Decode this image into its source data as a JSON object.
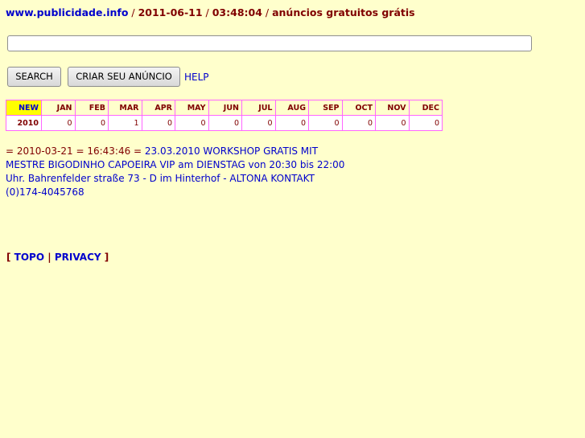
{
  "header": {
    "site": "www.publicidade.info",
    "date": "2011-06-11",
    "time": "03:48:04",
    "tagline": "anúncios gratuitos grátis",
    "separator": " / "
  },
  "search": {
    "value": "",
    "placeholder": ""
  },
  "buttons": {
    "search_label": "SEARCH",
    "create_label": "CRIAR SEU ANÚNCIO",
    "help_label": "HELP"
  },
  "calendar": {
    "new_label": "NEW",
    "months": [
      "JAN",
      "FEB",
      "MAR",
      "APR",
      "MAY",
      "JUN",
      "JUL",
      "AUG",
      "SEP",
      "OCT",
      "NOV",
      "DEC"
    ],
    "year": "2010",
    "counts": [
      "0",
      "0",
      "1",
      "0",
      "0",
      "0",
      "0",
      "0",
      "0",
      "0",
      "0",
      "0"
    ]
  },
  "listing": {
    "prefix": "= ",
    "date": "2010-03-21",
    "eq1": " = ",
    "time": "16:43:46",
    "eq2": " = ",
    "text": "23.03.2010 WORKSHOP GRATIS MIT MESTRE BIGODINHO CAPOEIRA VIP am DIENSTAG von 20:30 bis 22:00 Uhr. Bahrenfelder straße 73 - D im Hinterhof - ALTONA KONTAKT (0)174-4045768"
  },
  "footer": {
    "open": "[ ",
    "topo": "TOPO",
    "pipe": " | ",
    "privacy": "PRIVACY",
    "close": " ]"
  },
  "colors": {
    "background": "#ffffcc",
    "link": "#0000cc",
    "text": "#800000",
    "table_border": "#ff66ff",
    "new_cell": "#ffff00"
  }
}
